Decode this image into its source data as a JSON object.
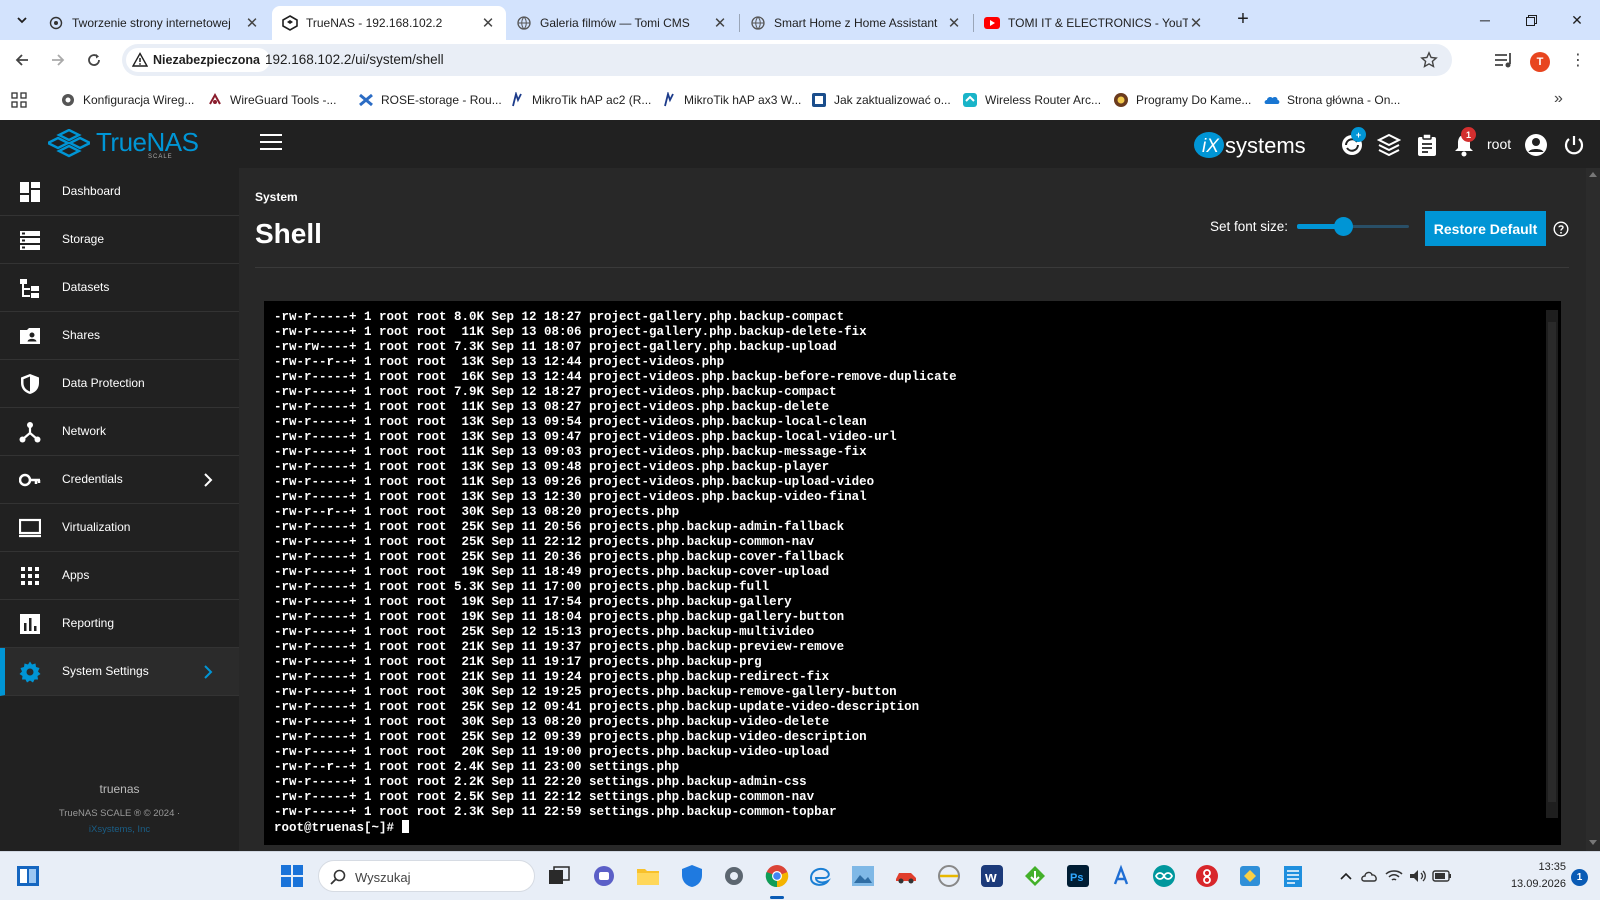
{
  "browser": {
    "tabs": [
      {
        "title": "Tworzenie strony internetowej",
        "favicon": "chatgpt-icon",
        "active": false
      },
      {
        "title": "TrueNAS - 192.168.102.2",
        "favicon": "truenas-icon",
        "active": true
      },
      {
        "title": "Galeria filmów — Tomi CMS",
        "favicon": "globe-icon",
        "active": false
      },
      {
        "title": "Smart Home z Home Assistant",
        "favicon": "globe-icon",
        "active": false
      },
      {
        "title": "TOMI IT & ELECTRONICS - YouT",
        "favicon": "youtube-icon",
        "active": false
      }
    ],
    "security_label": "Niezabezpieczona",
    "url": "192.168.102.2/ui/system/shell",
    "profile_initial": "T",
    "bookmarks": [
      {
        "label": "Konfiguracja Wireg...",
        "icon": "gear-dark-icon"
      },
      {
        "label": "WireGuard Tools -...",
        "icon": "wireguard-icon"
      },
      {
        "label": "ROSE-storage - Rou...",
        "icon": "rose-icon"
      },
      {
        "label": "MikroTik hAP ac2 (R...",
        "icon": "mikrotik-icon"
      },
      {
        "label": "MikroTik hAP ax3 W...",
        "icon": "mikrotik-icon"
      },
      {
        "label": "Jak zaktualizować o...",
        "icon": "doc-icon"
      },
      {
        "label": "Wireless Router Arc...",
        "icon": "router-icon"
      },
      {
        "label": "Programy Do Kame...",
        "icon": "camera-icon"
      },
      {
        "label": "Strona główna - On...",
        "icon": "onedrive-icon"
      }
    ]
  },
  "app": {
    "brand": "TrueNAS",
    "edition": "SCALE",
    "vendor_logo": "systems",
    "user": "root",
    "alerts_count": "1",
    "accent": "#0095d5"
  },
  "sidebar": {
    "items": [
      {
        "label": "Dashboard",
        "icon": "dashboard-icon"
      },
      {
        "label": "Storage",
        "icon": "storage-icon"
      },
      {
        "label": "Datasets",
        "icon": "datasets-icon"
      },
      {
        "label": "Shares",
        "icon": "shares-icon"
      },
      {
        "label": "Data Protection",
        "icon": "shield-icon"
      },
      {
        "label": "Network",
        "icon": "network-icon"
      },
      {
        "label": "Credentials",
        "icon": "key-icon"
      },
      {
        "label": "Virtualization",
        "icon": "monitor-icon"
      },
      {
        "label": "Apps",
        "icon": "apps-icon"
      },
      {
        "label": "Reporting",
        "icon": "chart-icon"
      },
      {
        "label": "System Settings",
        "icon": "gear-icon"
      }
    ],
    "hostname": "truenas",
    "version": "TrueNAS SCALE ® © 2024 ·",
    "company": "iXsystems, Inc"
  },
  "main": {
    "breadcrumb": "System",
    "title": "Shell",
    "font_size_label": "Set font size:",
    "font_size_level": 0.41,
    "restore_label": "Restore Default"
  },
  "terminal": {
    "lines": [
      "-rw-r-----+ 1 root root 8.0K Sep 12 18:27 project-gallery.php.backup-compact",
      "-rw-r-----+ 1 root root  11K Sep 13 08:06 project-gallery.php.backup-delete-fix",
      "-rw-rw----+ 1 root root 7.3K Sep 11 18:07 project-gallery.php.backup-upload",
      "-rw-r--r--+ 1 root root  13K Sep 13 12:44 project-videos.php",
      "-rw-r-----+ 1 root root  16K Sep 13 12:44 project-videos.php.backup-before-remove-duplicate",
      "-rw-r-----+ 1 root root 7.9K Sep 12 18:27 project-videos.php.backup-compact",
      "-rw-r-----+ 1 root root  11K Sep 13 08:27 project-videos.php.backup-delete",
      "-rw-r-----+ 1 root root  13K Sep 13 09:54 project-videos.php.backup-local-clean",
      "-rw-r-----+ 1 root root  13K Sep 13 09:47 project-videos.php.backup-local-video-url",
      "-rw-r-----+ 1 root root  11K Sep 13 09:03 project-videos.php.backup-message-fix",
      "-rw-r-----+ 1 root root  13K Sep 13 09:48 project-videos.php.backup-player",
      "-rw-r-----+ 1 root root  11K Sep 13 09:26 project-videos.php.backup-upload-video",
      "-rw-r-----+ 1 root root  13K Sep 13 12:30 project-videos.php.backup-video-final",
      "-rw-r--r--+ 1 root root  30K Sep 13 08:20 projects.php",
      "-rw-r-----+ 1 root root  25K Sep 11 20:56 projects.php.backup-admin-fallback",
      "-rw-r-----+ 1 root root  25K Sep 11 22:12 projects.php.backup-common-nav",
      "-rw-r-----+ 1 root root  25K Sep 11 20:36 projects.php.backup-cover-fallback",
      "-rw-r-----+ 1 root root  19K Sep 11 18:49 projects.php.backup-cover-upload",
      "-rw-r-----+ 1 root root 5.3K Sep 11 17:00 projects.php.backup-full",
      "-rw-r-----+ 1 root root  19K Sep 11 17:54 projects.php.backup-gallery",
      "-rw-r-----+ 1 root root  19K Sep 11 18:04 projects.php.backup-gallery-button",
      "-rw-r-----+ 1 root root  25K Sep 12 15:13 projects.php.backup-multivideo",
      "-rw-r-----+ 1 root root  21K Sep 11 19:37 projects.php.backup-preview-remove",
      "-rw-r-----+ 1 root root  21K Sep 11 19:17 projects.php.backup-prg",
      "-rw-r-----+ 1 root root  21K Sep 11 19:24 projects.php.backup-redirect-fix",
      "-rw-r-----+ 1 root root  30K Sep 12 19:25 projects.php.backup-remove-gallery-button",
      "-rw-r-----+ 1 root root  25K Sep 12 09:41 projects.php.backup-update-video-description",
      "-rw-r-----+ 1 root root  30K Sep 13 08:20 projects.php.backup-video-delete",
      "-rw-r-----+ 1 root root  25K Sep 12 09:39 projects.php.backup-video-description",
      "-rw-r-----+ 1 root root  20K Sep 11 19:00 projects.php.backup-video-upload",
      "-rw-r--r--+ 1 root root 2.4K Sep 11 23:00 settings.php",
      "-rw-r-----+ 1 root root 2.2K Sep 11 22:20 settings.php.backup-admin-css",
      "-rw-r-----+ 1 root root 2.5K Sep 11 22:12 settings.php.backup-common-nav",
      "-rw-r-----+ 1 root root 2.3K Sep 11 22:59 settings.php.backup-common-topbar"
    ],
    "prompt": "root@truenas[~]# "
  },
  "taskbar": {
    "search_placeholder": "Wyszukaj",
    "time": "13:35",
    "date": "13.09.2026",
    "notifications": "1"
  }
}
